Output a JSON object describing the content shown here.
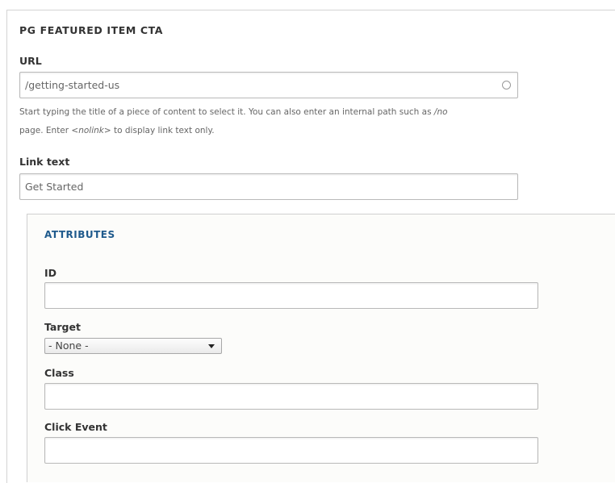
{
  "section": {
    "title": "PG FEATURED ITEM CTA"
  },
  "url_field": {
    "label": "URL",
    "value": "/getting-started-us",
    "help_line1_prefix": "Start typing the title of a piece of content to select it. You can also enter an internal path such as ",
    "help_line1_code": "/no",
    "help_line2_prefix": "page. Enter ",
    "help_line2_code": "<nolink>",
    "help_line2_suffix": " to display link text only."
  },
  "link_text_field": {
    "label": "Link text",
    "value": "Get Started"
  },
  "attributes": {
    "legend": "ATTRIBUTES",
    "id_label": "ID",
    "id_value": "",
    "target_label": "Target",
    "target_selected": "- None -",
    "class_label": "Class",
    "class_value": "",
    "click_event_label": "Click Event",
    "click_event_value": ""
  },
  "icons": {
    "url_autocomplete": "autocomplete-throbber-icon",
    "select_caret": "chevron-down-icon"
  }
}
